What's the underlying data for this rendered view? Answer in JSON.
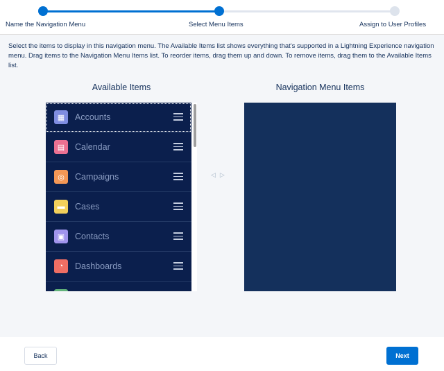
{
  "progress": {
    "steps": [
      {
        "label": "Name the Navigation Menu",
        "state": "complete"
      },
      {
        "label": "Select Menu Items",
        "state": "current"
      },
      {
        "label": "Assign to User Profiles",
        "state": "incomplete"
      }
    ]
  },
  "instructions": "Select the items to display in this navigation menu. The Available Items list shows everything that's supported in a Lightning Experience navigation menu. Drag items to the Navigation Menu Items list. To reorder items, drag them up and down. To remove items, drag them to the Available Items list.",
  "available": {
    "title": "Available Items",
    "items": [
      {
        "label": "Accounts",
        "icon": "accounts-icon",
        "glyph": "▦",
        "color": "#7f8de1"
      },
      {
        "label": "Calendar",
        "icon": "calendar-icon",
        "glyph": "▤",
        "color": "#eb7092"
      },
      {
        "label": "Campaigns",
        "icon": "campaigns-icon",
        "glyph": "◎",
        "color": "#f49756"
      },
      {
        "label": "Cases",
        "icon": "cases-icon",
        "glyph": "▬",
        "color": "#f2cf5b"
      },
      {
        "label": "Contacts",
        "icon": "contacts-icon",
        "glyph": "▣",
        "color": "#a094ed"
      },
      {
        "label": "Dashboards",
        "icon": "dashboards-icon",
        "glyph": "◔",
        "color": "#ef6e64"
      },
      {
        "label": "",
        "icon": "partial-item-icon",
        "glyph": "",
        "color": "#62b37a"
      }
    ]
  },
  "selected": {
    "title": "Navigation Menu Items"
  },
  "move_controls": {
    "left_glyph": "◁",
    "right_glyph": "▷"
  },
  "footer": {
    "back_label": "Back",
    "next_label": "Next"
  },
  "colors": {
    "brand": "#0070d2",
    "list_background": "#0b1f4d",
    "selected_list_background": "#14305c",
    "page_background": "#f4f6f9"
  }
}
